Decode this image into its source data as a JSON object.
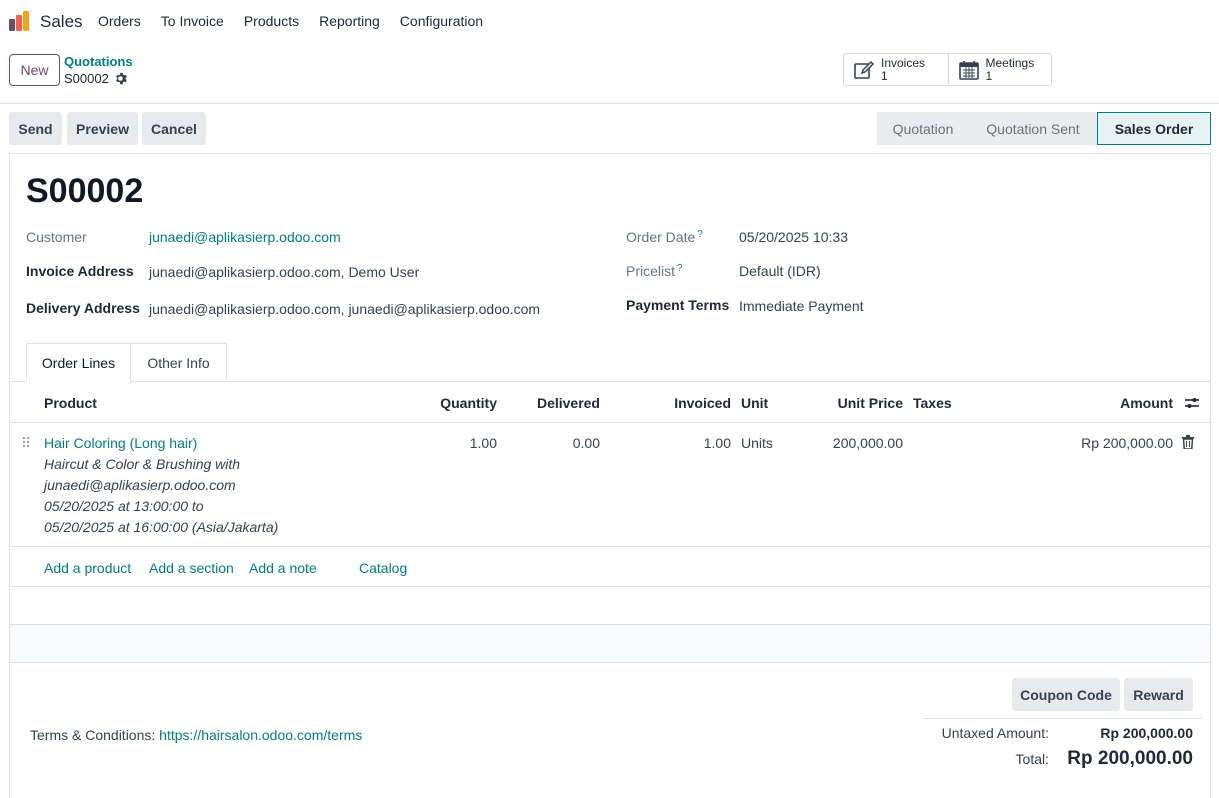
{
  "app": {
    "name": "Sales"
  },
  "nav": [
    "Orders",
    "To Invoice",
    "Products",
    "Reporting",
    "Configuration"
  ],
  "control": {
    "new_label": "New",
    "breadcrumb_parent": "Quotations",
    "breadcrumb_current": "S00002",
    "smart_buttons": [
      {
        "label": "Invoices",
        "count": "1",
        "icon": "edit-icon"
      },
      {
        "label": "Meetings",
        "count": "1",
        "icon": "calendar-icon"
      }
    ]
  },
  "actions": {
    "send": "Send",
    "preview": "Preview",
    "cancel": "Cancel"
  },
  "stages": [
    "Quotation",
    "Quotation Sent",
    "Sales Order"
  ],
  "active_stage": "Sales Order",
  "form": {
    "name": "S00002",
    "customer_label": "Customer",
    "customer": "junaedi@aplikasierp.odoo.com",
    "invoice_address_label": "Invoice Address",
    "invoice_address": "junaedi@aplikasierp.odoo.com, Demo User",
    "delivery_address_label": "Delivery Address",
    "delivery_address": "junaedi@aplikasierp.odoo.com, junaedi@aplikasierp.odoo.com",
    "order_date_label": "Order Date",
    "order_date": "05/20/2025 10:33",
    "pricelist_label": "Pricelist",
    "pricelist": "Default (IDR)",
    "payment_terms_label": "Payment Terms",
    "payment_terms": "Immediate Payment",
    "help_mark": "?"
  },
  "tabs": [
    "Order Lines",
    "Other Info"
  ],
  "table": {
    "headers": {
      "product": "Product",
      "quantity": "Quantity",
      "delivered": "Delivered",
      "invoiced": "Invoiced",
      "unit": "Unit",
      "unit_price": "Unit Price",
      "taxes": "Taxes",
      "amount": "Amount"
    },
    "lines": [
      {
        "product": "Hair Coloring (Long hair)",
        "description": [
          "Haircut & Color & Brushing with",
          "junaedi@aplikasierp.odoo.com",
          "05/20/2025 at 13:00:00 to",
          "05/20/2025 at 16:00:00 (Asia/Jakarta)"
        ],
        "quantity": "1.00",
        "delivered": "0.00",
        "invoiced": "1.00",
        "unit": "Units",
        "unit_price": "200,000.00",
        "taxes": "",
        "amount": "Rp 200,000.00"
      }
    ],
    "add_links": {
      "product": "Add a product",
      "section": "Add a section",
      "note": "Add a note",
      "catalog": "Catalog"
    }
  },
  "footer": {
    "coupon": "Coupon Code",
    "reward": "Reward",
    "terms_label": "Terms & Conditions:",
    "terms_link": "https://hairsalon.odoo.com/terms",
    "untaxed_label": "Untaxed Amount:",
    "untaxed_value": "Rp 200,000.00",
    "total_label": "Total:",
    "total_value": "Rp 200,000.00"
  },
  "colors": {
    "brand": "#714b67",
    "accent": "#017e84"
  }
}
